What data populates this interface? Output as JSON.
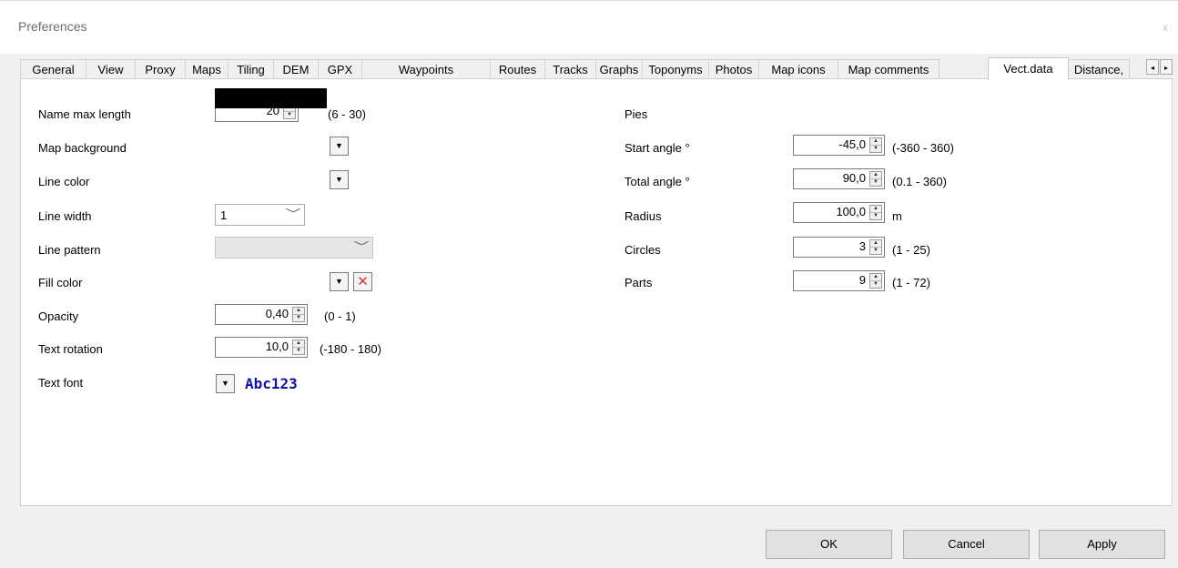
{
  "window": {
    "title": "Preferences",
    "close_label": "x"
  },
  "tabs": [
    {
      "label": "General"
    },
    {
      "label": "View"
    },
    {
      "label": "Proxy"
    },
    {
      "label": "Maps"
    },
    {
      "label": "Tiling"
    },
    {
      "label": "DEM"
    },
    {
      "label": "GPX"
    },
    {
      "label": "Waypoints"
    },
    {
      "label": "Routes"
    },
    {
      "label": "Tracks"
    },
    {
      "label": "Graphs"
    },
    {
      "label": "Toponyms"
    },
    {
      "label": "Photos"
    },
    {
      "label": "Map icons"
    },
    {
      "label": "Map comments"
    },
    {
      "label": "Vect.data"
    },
    {
      "label": "Distance,"
    }
  ],
  "active_tab": "Vect.data",
  "tab_scroll": {
    "left": "◂",
    "right": "▸"
  },
  "left": {
    "name_max_length": {
      "label": "Name max length",
      "value": "20",
      "range": "(6 - 30)"
    },
    "map_background": {
      "label": "Map background"
    },
    "line_color": {
      "label": "Line color",
      "color": "#000000"
    },
    "line_width": {
      "label": "Line width",
      "value": "1"
    },
    "line_pattern": {
      "label": "Line pattern",
      "value": ""
    },
    "fill_color": {
      "label": "Fill color"
    },
    "opacity": {
      "label": "Opacity",
      "value": "0,40",
      "range": "(0 - 1)"
    },
    "text_rotation": {
      "label": "Text rotation",
      "value": "10,0",
      "range": "(-180 - 180)"
    },
    "text_font": {
      "label": "Text font",
      "sample": "Abc123",
      "sample_color": "#1111aa"
    }
  },
  "right": {
    "pies_header": "Pies",
    "start_angle": {
      "label": "Start angle °",
      "value": "-45,0",
      "range": "(-360 - 360)"
    },
    "total_angle": {
      "label": "Total angle °",
      "value": "90,0",
      "range": "(0.1 - 360)"
    },
    "radius": {
      "label": "Radius",
      "value": "100,0",
      "unit": "m"
    },
    "circles": {
      "label": "Circles",
      "value": "3",
      "range": "(1 - 25)"
    },
    "parts": {
      "label": "Parts",
      "value": "9",
      "range": "(1 - 72)"
    }
  },
  "buttons": {
    "ok": "OK",
    "cancel": "Cancel",
    "apply": "Apply"
  },
  "icons": {
    "spin_up": "▲",
    "spin_down": "▼",
    "dropdown": "▼",
    "chevron": "﹀",
    "clear": "✕"
  }
}
